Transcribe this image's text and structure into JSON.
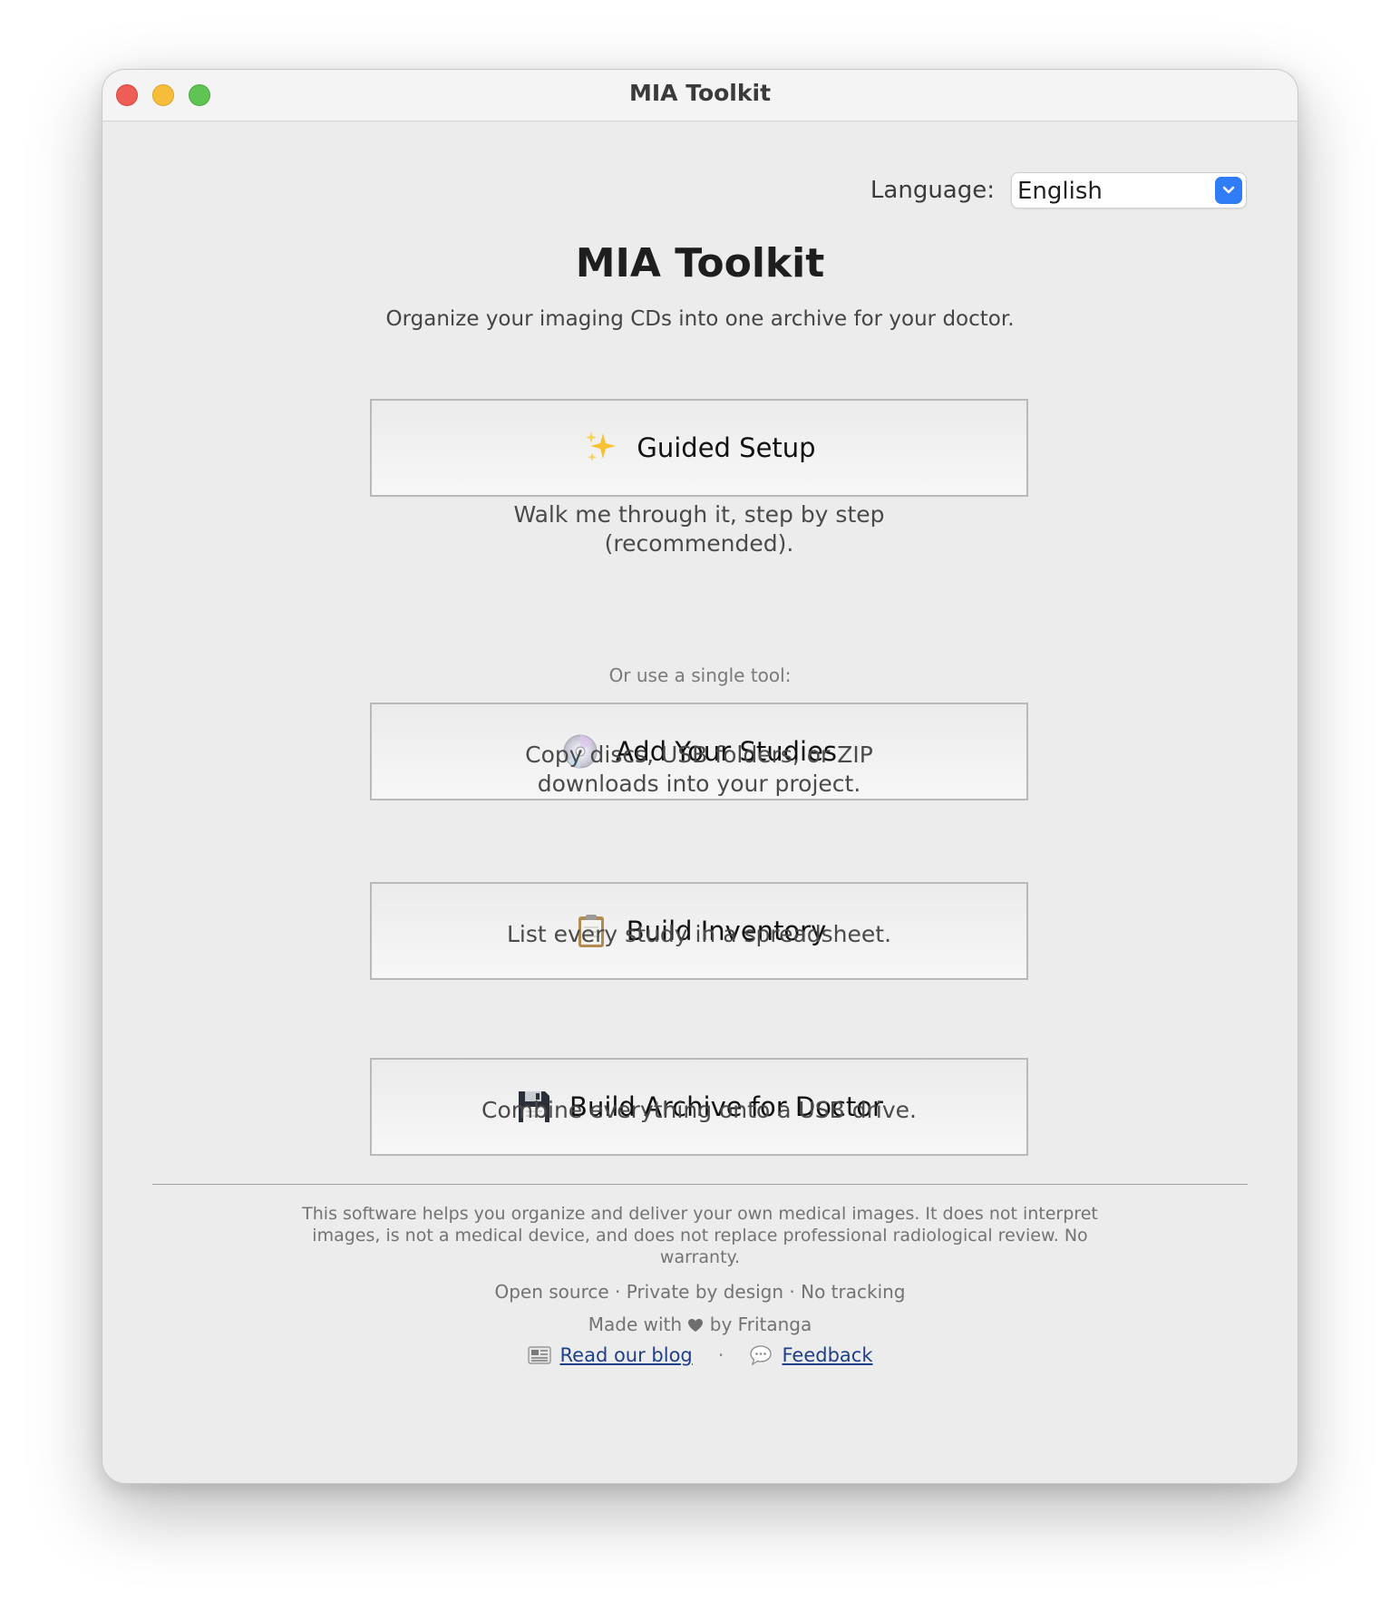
{
  "window": {
    "title": "MIA Toolkit"
  },
  "language": {
    "label": "Language:",
    "selected": "English"
  },
  "header": {
    "title": "MIA Toolkit",
    "subtitle": "Organize your imaging CDs into one archive for your doctor."
  },
  "guided": {
    "icon": "sparkles-icon",
    "label": "Guided Setup",
    "desc_line1": "Walk me through it, step by step",
    "desc_line2": "(recommended)."
  },
  "or_label": "Or use a single tool:",
  "tools": [
    {
      "icon": "disc-icon",
      "label": "Add Your Studies",
      "desc_line1": "Copy discs, USB folders, or ZIP",
      "desc_line2": "downloads into your project."
    },
    {
      "icon": "clipboard-icon",
      "label": "Build Inventory",
      "desc_line1": "List every study in a spreadsheet."
    },
    {
      "icon": "floppy-disk-icon",
      "label": "Build Archive for Doctor",
      "desc_line1": "Combine everything onto a USB drive."
    }
  ],
  "footer": {
    "disclaimer_line1": "This software helps you organize and deliver your own medical images. It does not interpret",
    "disclaimer_line2": "images, is not a medical device, and does not replace professional radiological review. No",
    "disclaimer_line3": "warranty.",
    "tags": "Open source · Private by design · No tracking",
    "made_with_prefix": "Made with",
    "made_with_suffix": "by Fritanga",
    "blog_label": "Read our blog",
    "separator": "·",
    "feedback_label": "Feedback"
  },
  "colors": {
    "accent": "#2f7cf6",
    "link": "#1f3f8a",
    "close": "#ee5e56",
    "minimize": "#f5bd3a",
    "maximize": "#5fc454"
  }
}
